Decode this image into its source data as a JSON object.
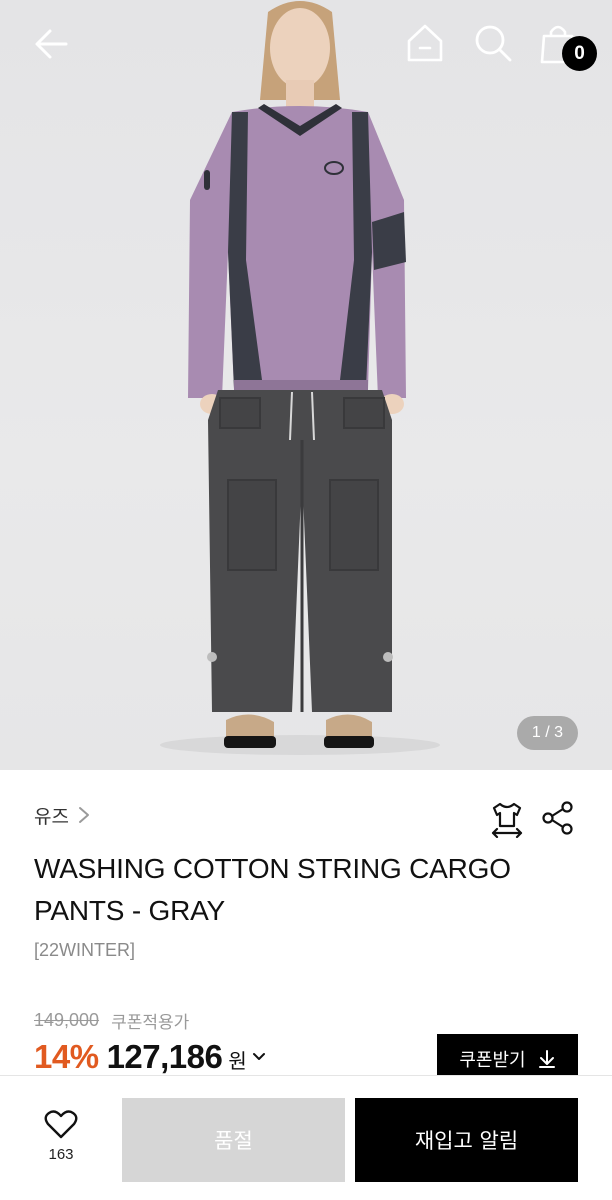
{
  "header": {
    "icons": [
      "arrow-left-icon",
      "home-icon",
      "search-icon",
      "shopping-bag-icon"
    ],
    "cart_count": "0"
  },
  "gallery": {
    "pager": "1 / 3"
  },
  "product": {
    "brand": "유즈",
    "name": "WASHING COTTON STRING CARGO PANTS - GRAY",
    "season": "[22WINTER]",
    "original_price": "149,000",
    "coupon_price_label": "쿠폰적용가",
    "discount": "14%",
    "price": "127,186",
    "currency": "원",
    "actions": [
      "size-guide-icon",
      "share-icon"
    ]
  },
  "coupon_button": {
    "label": "쿠폰받기",
    "icon": "download-icon"
  },
  "bottom_bar": {
    "like_count": "163",
    "sold_out_label": "품절",
    "restock_label": "재입고 알림"
  },
  "colors": {
    "discount": "#e15a20",
    "button_dark": "#000000",
    "button_disabled": "#d6d6d6"
  }
}
